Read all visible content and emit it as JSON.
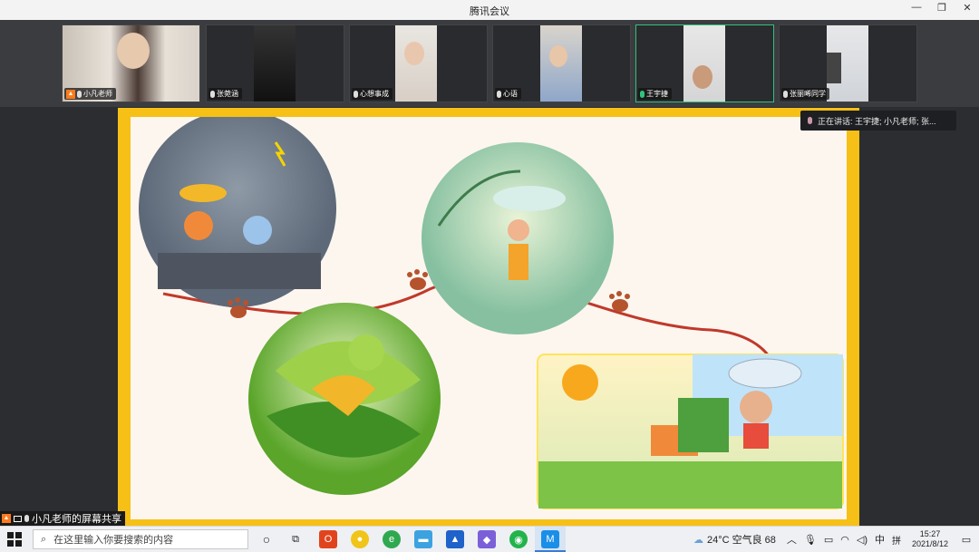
{
  "window": {
    "title": "腾讯会议"
  },
  "participants": [
    {
      "name": "小凡老师",
      "host": true,
      "mic": "off",
      "active": false
    },
    {
      "name": "张菀涵",
      "host": false,
      "mic": "muted",
      "active": false
    },
    {
      "name": "心想事成",
      "host": false,
      "mic": "muted",
      "active": false
    },
    {
      "name": "心语",
      "host": false,
      "mic": "muted",
      "active": false
    },
    {
      "name": "王宇捷",
      "host": false,
      "mic": "on",
      "active": true
    },
    {
      "name": "张丽晞同学",
      "host": false,
      "mic": "off",
      "active": false
    }
  ],
  "speaking": {
    "text": "正在讲话: 王宇捷; 小凡老师; 张..."
  },
  "share": {
    "label": "小凡老师的屏幕共享"
  },
  "taskbar": {
    "search_placeholder": "在这里输入你要搜索的内容",
    "weather": "24°C 空气良 68",
    "ime": "中",
    "ime2": "拼",
    "time": "15:27",
    "date": "2021/8/12"
  },
  "colors": {
    "accent": "#31c27c",
    "slide_border": "#f7c016",
    "path": "#c0392b"
  }
}
